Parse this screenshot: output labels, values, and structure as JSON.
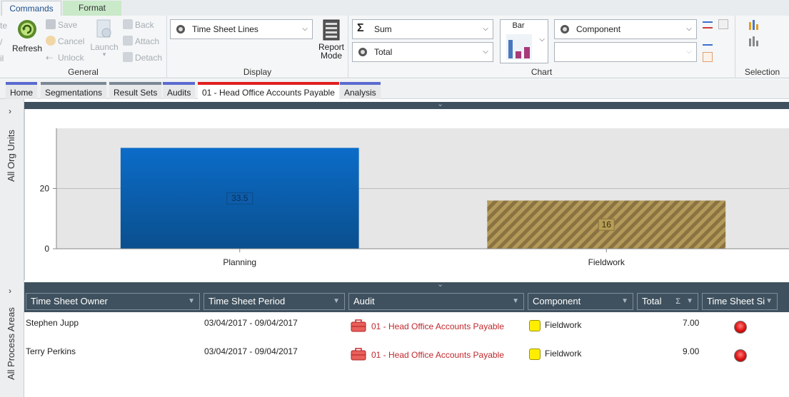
{
  "ribbon": {
    "tabs": [
      {
        "label": "Commands"
      },
      {
        "label": "Format"
      }
    ],
    "general": {
      "label": "General",
      "refresh": "Refresh",
      "save": "Save",
      "cancel": "Cancel",
      "unlock": "Unlock",
      "launch": "Launch",
      "back": "Back",
      "attach": "Attach",
      "detach": "Detach",
      "cut_left_top": "te",
      "cut_left_mid": "/",
      "cut_left_bot": "il"
    },
    "display": {
      "label": "Display",
      "view_select": "Time Sheet Lines",
      "report_mode_line1": "Report",
      "report_mode_line2": "Mode"
    },
    "chart": {
      "label": "Chart",
      "aggregate": "Sum",
      "measure": "Total",
      "chart_type": "Bar",
      "group_by": "Component",
      "series_by": ""
    },
    "selection": {
      "label": "Selection"
    }
  },
  "doctabs": [
    {
      "label": "Home"
    },
    {
      "label": "Segmentations"
    },
    {
      "label": "Result Sets"
    },
    {
      "label": "Audits"
    },
    {
      "label": "01 - Head Office Accounts Payable"
    },
    {
      "label": "Analysis"
    }
  ],
  "sidebar": {
    "top_label": "All Org Units",
    "bottom_label": "All Process Areas"
  },
  "chart_data": {
    "type": "bar",
    "categories": [
      "Planning",
      "Fieldwork"
    ],
    "values": [
      33.5,
      16
    ],
    "data_labels": [
      "33.5",
      "16"
    ],
    "y_ticks": [
      "0",
      "20"
    ],
    "ylim": [
      0,
      40
    ],
    "grid": true,
    "colors": [
      "#0b5fb0",
      "#a8904a"
    ]
  },
  "grid": {
    "columns": [
      {
        "label": "Time Sheet Owner"
      },
      {
        "label": "Time Sheet Period"
      },
      {
        "label": "Audit"
      },
      {
        "label": "Component"
      },
      {
        "label": "Total",
        "sigma": "Σ"
      },
      {
        "label": "Time Sheet Si"
      }
    ],
    "rows": [
      {
        "owner": "Stephen Jupp",
        "period": "03/04/2017 - 09/04/2017",
        "audit": "01 - Head Office Accounts Payable",
        "component": "Fieldwork",
        "total": "7.00"
      },
      {
        "owner": "Terry Perkins",
        "period": "03/04/2017 - 09/04/2017",
        "audit": "01 - Head Office Accounts Payable",
        "component": "Fieldwork",
        "total": "9.00"
      }
    ]
  },
  "colors": {
    "accent": "#1d4f8a",
    "header_dark": "#3f515e",
    "audit_text": "#c0282d",
    "status_yellow": "#ffee00"
  }
}
